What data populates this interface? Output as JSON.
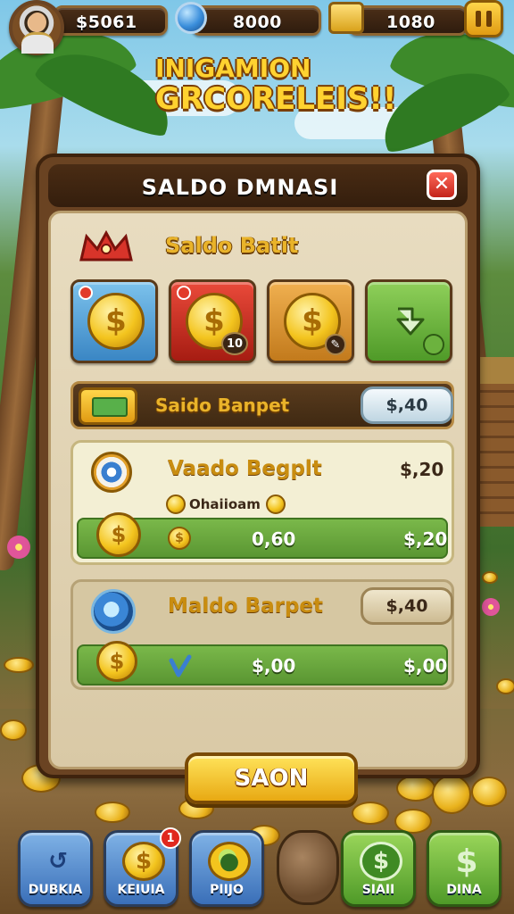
{
  "topbar": {
    "money": "$5061",
    "gems": "8000",
    "gold": "1080"
  },
  "headline": {
    "line1": "INIGAMION",
    "line2": "GRCORELEIS!!"
  },
  "modal": {
    "title": "SALDO DMNASI",
    "close_label": "✕",
    "section_title": "Saldo Batit",
    "tiles": [
      {
        "badge": "",
        "color": "#4fa3d8"
      },
      {
        "badge": "10",
        "color": "#c82a1e"
      },
      {
        "badge": "",
        "color": "#d8952a"
      },
      {
        "badge": "",
        "color": "#6cb23e"
      }
    ],
    "balance_row": {
      "label": "Saido Banpet",
      "value": "$,40"
    },
    "card1": {
      "title": "Vaado Begplt",
      "value": "$,20",
      "sub_label": "Ohaiioam",
      "strip_mid": "0,60",
      "strip_value": "$,20"
    },
    "card2": {
      "title": "Maldo Barpet",
      "pill_value": "$,40",
      "strip_mid": "$,00",
      "strip_value": "$,00"
    },
    "primary_button": "SAON"
  },
  "bottom_nav": [
    {
      "label": "DUBKIA",
      "icon": "refresh-arrow-icon",
      "notify": ""
    },
    {
      "label": "KEIUIA",
      "icon": "coin-icon",
      "notify": "1"
    },
    {
      "label": "PIIJO",
      "icon": "map-pin-icon",
      "notify": ""
    },
    {
      "label": "SIAII",
      "icon": "recycle-dollar-icon",
      "notify": ""
    },
    {
      "label": "DINA",
      "icon": "dollar-icon",
      "notify": ""
    }
  ]
}
